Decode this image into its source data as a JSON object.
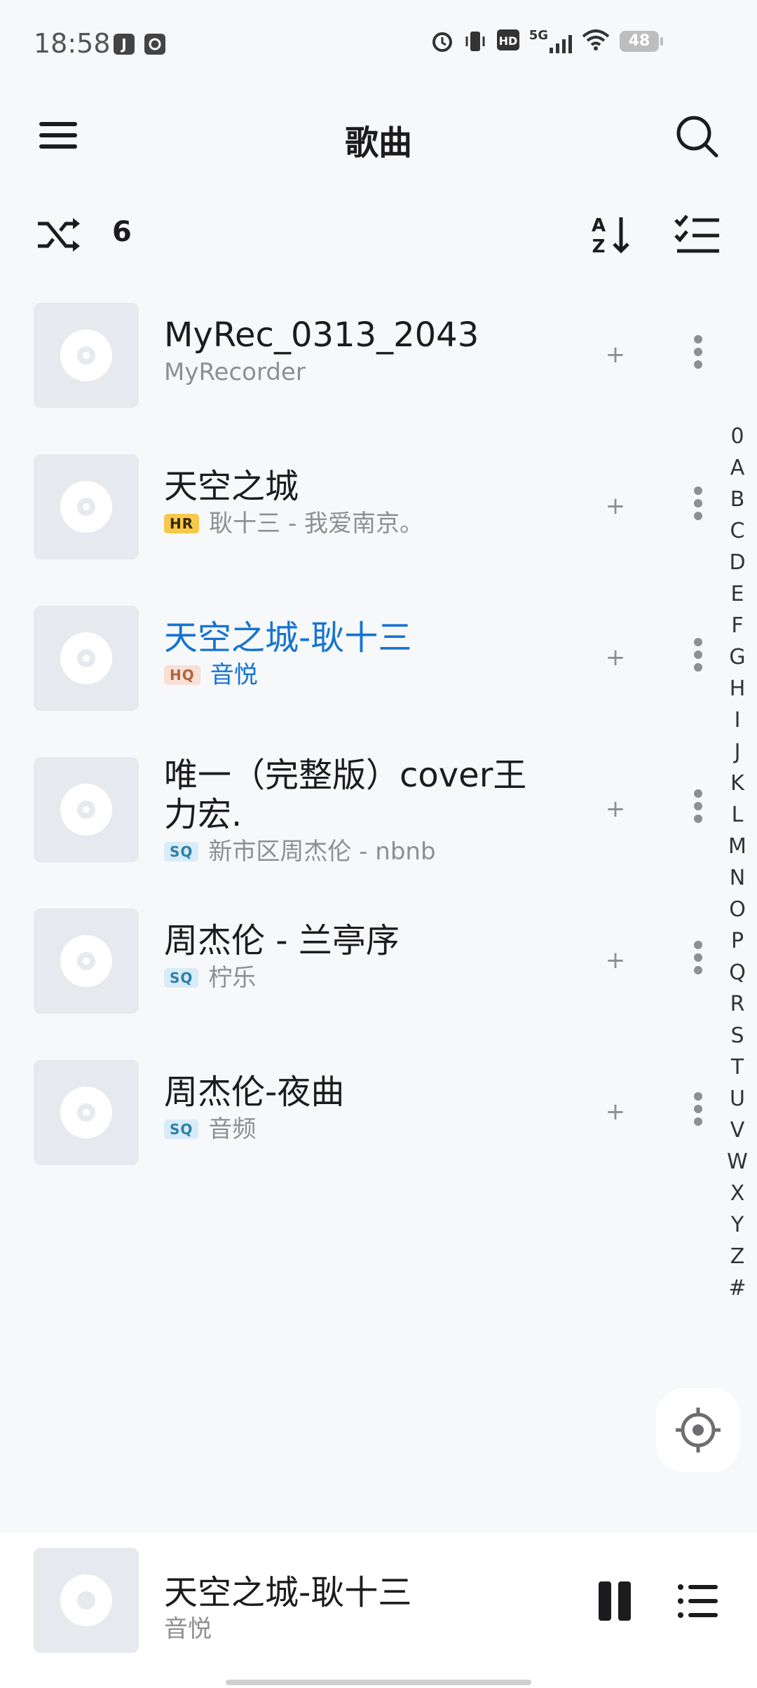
{
  "status_bar": {
    "time": "18:58",
    "app_icon_1": "J",
    "network": "5G",
    "hd": "HD",
    "battery": "48"
  },
  "header": {
    "title": "歌曲"
  },
  "toolbar": {
    "count": "6"
  },
  "songs": [
    {
      "title": "MyRec_0313_2043",
      "badge": "",
      "subtitle": "MyRecorder"
    },
    {
      "title": "天空之城",
      "badge": "HR",
      "subtitle": "耿十三 - 我爱南京。"
    },
    {
      "title": "天空之城-耿十三",
      "badge": "HQ",
      "subtitle": "音悦"
    },
    {
      "title": "唯一（完整版）cover王力宏.",
      "badge": "SQ",
      "subtitle": "新市区周杰伦 - nbnb"
    },
    {
      "title": "周杰伦 - 兰亭序",
      "badge": "SQ",
      "subtitle": "柠乐"
    },
    {
      "title": "周杰伦-夜曲",
      "badge": "SQ",
      "subtitle": "音频"
    }
  ],
  "alpha_index": [
    "0",
    "A",
    "B",
    "C",
    "D",
    "E",
    "F",
    "G",
    "H",
    "I",
    "J",
    "K",
    "L",
    "M",
    "N",
    "O",
    "P",
    "Q",
    "R",
    "S",
    "T",
    "U",
    "V",
    "W",
    "X",
    "Y",
    "Z",
    "#"
  ],
  "now_playing": {
    "title": "天空之城-耿十三",
    "subtitle": "音悦"
  },
  "colors": {
    "accent": "#1674d1",
    "background": "#f7f8fa"
  }
}
